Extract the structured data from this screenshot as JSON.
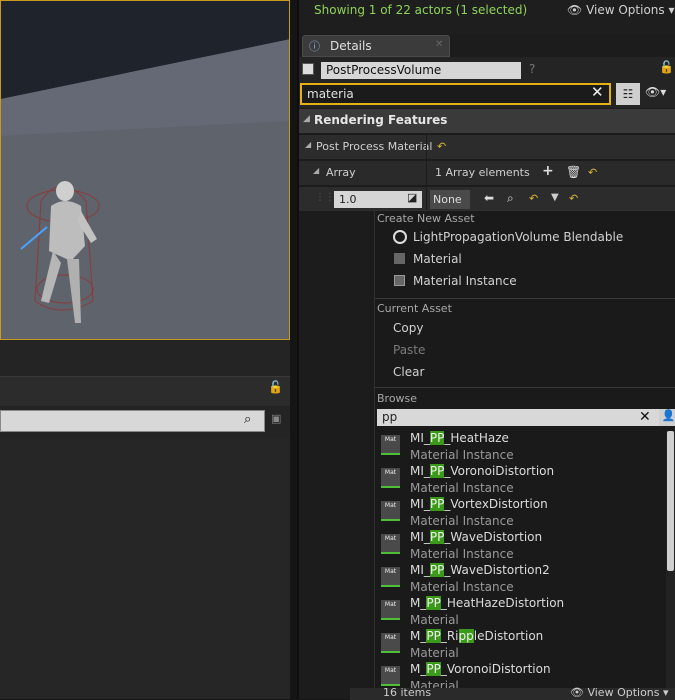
{
  "outliner": {
    "status": "Showing 1 of 22 actors (1 selected)",
    "view_options": "View Options"
  },
  "details": {
    "tab_label": "Details",
    "actor_name": "PostProcessVolume",
    "search_value": "materia",
    "category": "Rendering Features",
    "property": "Post Process Material",
    "array_label": "Array",
    "array_count": "1 Array elements",
    "element_weight": "1.0",
    "element_asset": "None"
  },
  "dropdown": {
    "create_header": "Create New Asset",
    "create_items": [
      "LightPropagationVolume Blendable",
      "Material",
      "Material Instance"
    ],
    "current_header": "Current Asset",
    "current_items": [
      "Copy",
      "Paste",
      "Clear"
    ],
    "browse_header": "Browse",
    "browse_search": "pp",
    "assets": [
      {
        "pre": "MI_",
        "hl": "PP",
        "post": "_HeatHaze",
        "type": "Material Instance"
      },
      {
        "pre": "MI_",
        "hl": "PP",
        "post": "_VoronoiDistortion",
        "type": "Material Instance"
      },
      {
        "pre": "MI_",
        "hl": "PP",
        "post": "_VortexDistortion",
        "type": "Material Instance"
      },
      {
        "pre": "MI_",
        "hl": "PP",
        "post": "_WaveDistortion",
        "type": "Material Instance"
      },
      {
        "pre": "MI_",
        "hl": "PP",
        "post": "_WaveDistortion2",
        "type": "Material Instance"
      },
      {
        "pre": "M_",
        "hl": "PP",
        "post": "_HeatHazeDistortion",
        "type": "Material"
      },
      {
        "pre": "M_",
        "hl": "PP",
        "post": "_RippleDistortion",
        "type": "Material",
        "hl2": "pp"
      },
      {
        "pre": "M_",
        "hl": "PP",
        "post": "_VoronoiDistortion",
        "type": "Material"
      }
    ],
    "thumb_label": "Mat",
    "footer_count": "16 items",
    "footer_view": "View Options"
  },
  "colors": {
    "accent": "#e4b012",
    "highlight": "#3c9a1a",
    "status_text": "#8fd35a"
  }
}
